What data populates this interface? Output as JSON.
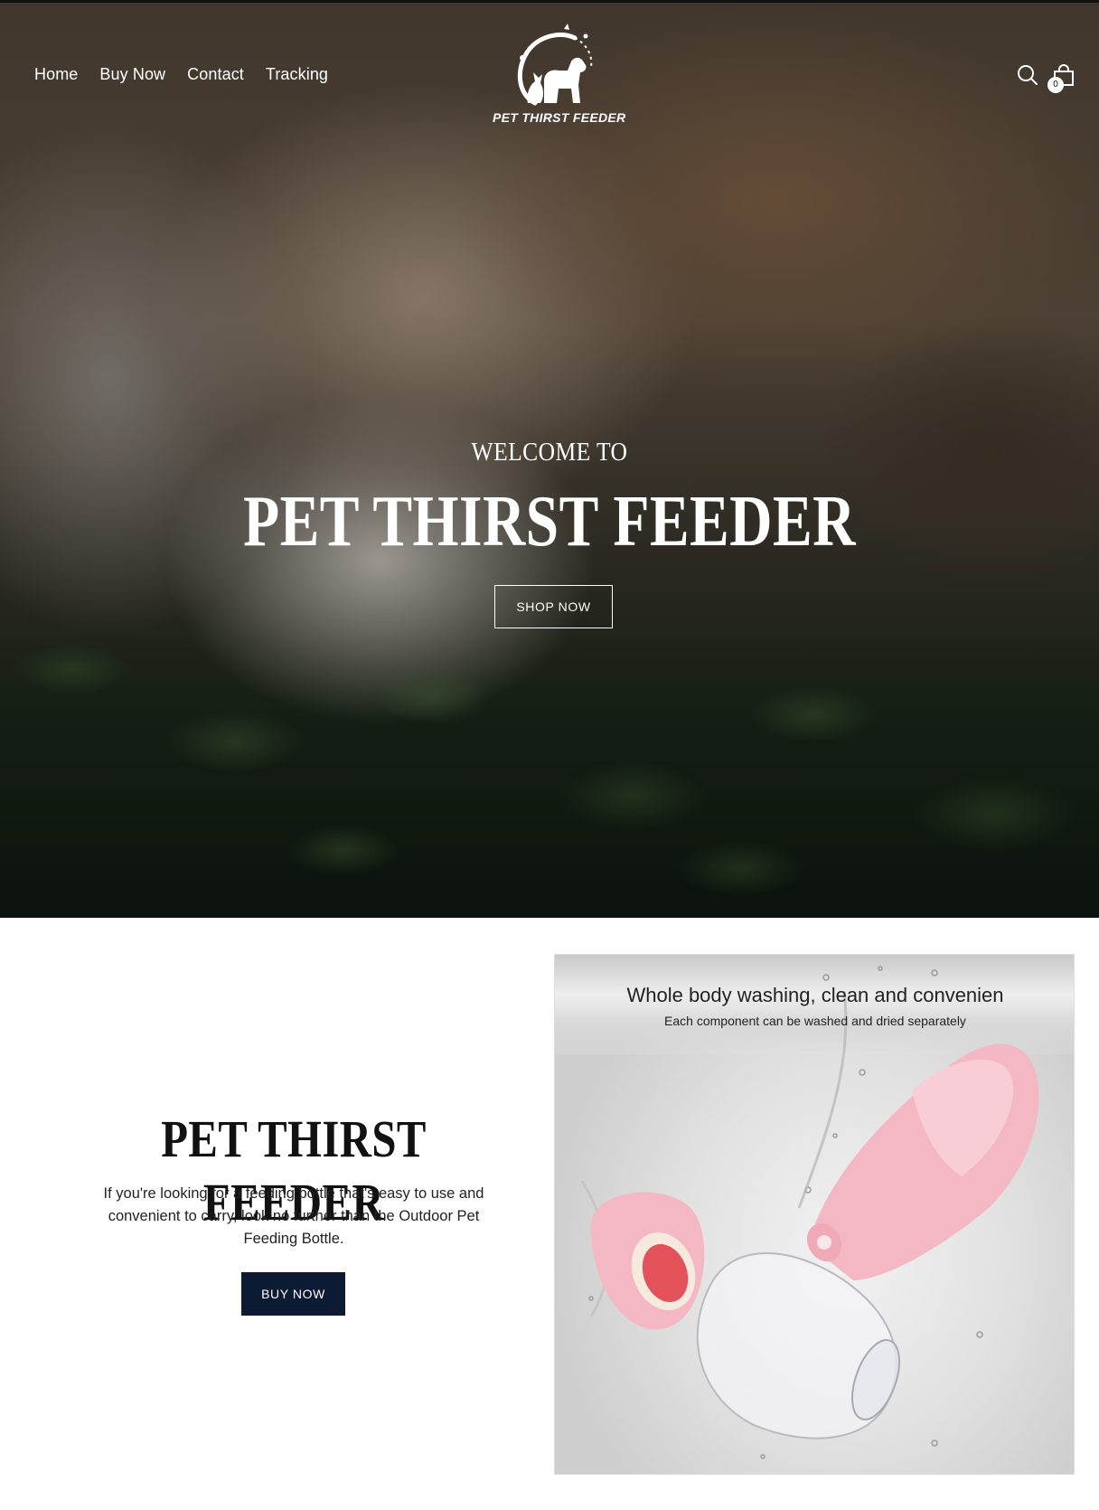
{
  "header": {
    "nav": [
      "Home",
      "Buy Now",
      "Contact",
      "Tracking"
    ],
    "logo_text": "PET THIRST FEEDER",
    "cart_count": "0",
    "icons": {
      "search": "search-icon",
      "cart": "shopping-bag-icon",
      "logo": "cat-and-dog-logo-icon"
    }
  },
  "hero": {
    "kicker": "WELCOME TO",
    "title": "PET THIRST FEEDER",
    "button": "SHOP NOW"
  },
  "feature": {
    "title": "PET THIRST FEEDER",
    "description": "If you're looking for a feeding bottle that's easy to use and convenient to carry, look no further than the Outdoor Pet Feeding Bottle.",
    "button": "BUY NOW",
    "image": {
      "headline": "Whole body washing,  clean and convenien",
      "subline": "Each component can be washed and dried separately"
    }
  },
  "colors": {
    "button_dark": "#0d1a33",
    "text_white": "#ffffff",
    "product_pink": "#f4b8c4"
  }
}
